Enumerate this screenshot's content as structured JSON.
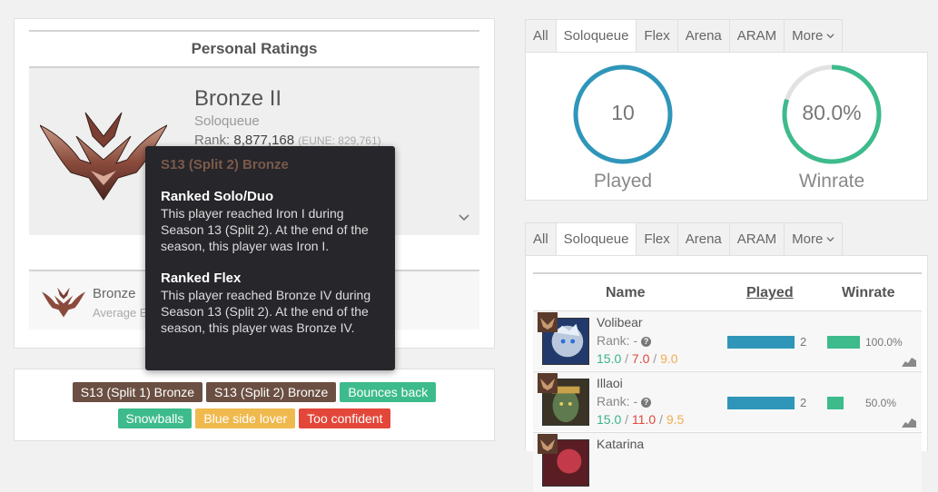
{
  "ratings": {
    "title": "Personal Ratings",
    "rank_name": "Bronze II",
    "queue": "Soloqueue",
    "rank_label": "Rank:",
    "rank_number": "8,877,168",
    "rank_region": "(EUNE: 829,761)",
    "avg_title": "Bronze",
    "avg_sub": "Average E"
  },
  "tooltip": {
    "title": "S13 (Split 2) Bronze",
    "sections": [
      {
        "head": "Ranked Solo/Duo",
        "text": "This player reached Iron I during Season 13 (Split 2). At the end of the season, this player was Iron I."
      },
      {
        "head": "Ranked Flex",
        "text": "This player reached Bronze IV during Season 13 (Split 2). At the end of the season, this player was Bronze IV."
      }
    ]
  },
  "tags": [
    {
      "label": "S13 (Split 1) Bronze",
      "color": "#6b4f42"
    },
    {
      "label": "S13 (Split 2) Bronze",
      "color": "#6b4f42"
    },
    {
      "label": "Bounces back",
      "color": "#3dbb8c"
    },
    {
      "label": "Snowballs",
      "color": "#3dbb8c"
    },
    {
      "label": "Blue side lover",
      "color": "#f0b94e"
    },
    {
      "label": "Too confident",
      "color": "#e2473a"
    }
  ],
  "tabs": [
    "All",
    "Soloqueue",
    "Flex",
    "Arena",
    "ARAM",
    "More"
  ],
  "stats": {
    "played_value": "10",
    "played_label": "Played",
    "winrate_value": "80.0%",
    "winrate_label": "Winrate",
    "winrate_fraction": 0.8
  },
  "champions": {
    "headers": {
      "name": "Name",
      "played": "Played",
      "winrate": "Winrate"
    },
    "rank_text": "Rank: -",
    "rows": [
      {
        "name": "Volibear",
        "k": "15.0",
        "d": "7.0",
        "a": "9.0",
        "played": "2",
        "played_fraction": 1.0,
        "winrate": "100.0%",
        "winrate_fraction": 1.0
      },
      {
        "name": "Illaoi",
        "k": "15.0",
        "d": "11.0",
        "a": "9.5",
        "played": "2",
        "played_fraction": 1.0,
        "winrate": "50.0%",
        "winrate_fraction": 0.5
      },
      {
        "name": "Katarina"
      }
    ]
  },
  "colors": {
    "played_ring": "#2f96b9",
    "winrate_ring": "#3dbb8c",
    "ring_track": "#e2e2e2"
  }
}
